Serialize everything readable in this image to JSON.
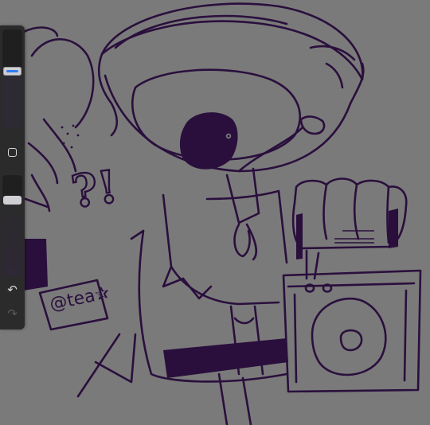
{
  "app": {
    "background_color": "#7a7a7a",
    "ink_color": "#2a0f3d"
  },
  "sidebar": {
    "brush_size": {
      "level": 0.58,
      "accent_color": "#2f7df6"
    },
    "modify_button": {
      "icon": "square-outline-icon"
    },
    "brush_opacity": {
      "level": 0.78
    },
    "undo": {
      "icon": "undo-arrow-icon",
      "glyph": "↶",
      "enabled": true
    },
    "redo": {
      "icon": "redo-arrow-icon",
      "glyph": "↷",
      "enabled": false
    }
  },
  "artwork": {
    "exclamation_text": "?!",
    "signature_text": "@tea✰"
  }
}
